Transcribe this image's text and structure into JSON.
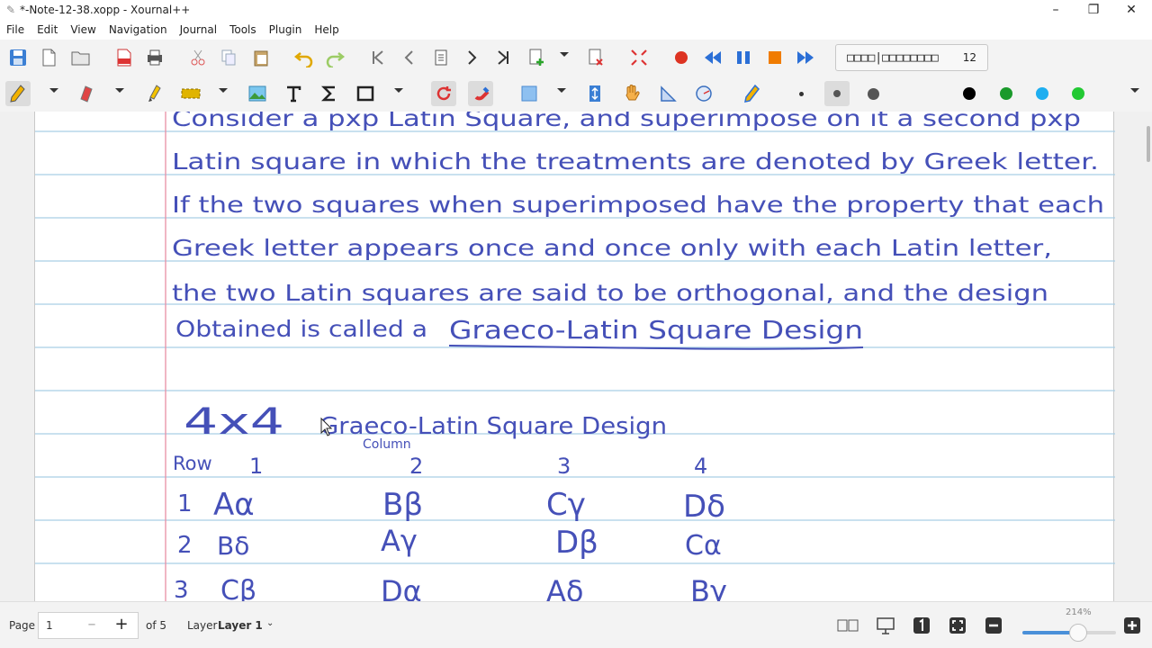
{
  "window": {
    "title": "*-Note-12-38.xopp - Xournal++",
    "minimize": "–",
    "maximize": "❐",
    "close": "✕"
  },
  "menu": [
    "File",
    "Edit",
    "View",
    "Navigation",
    "Journal",
    "Tools",
    "Plugin",
    "Help"
  ],
  "toolbar": {
    "page_selector_name": "□□□□|□□□□□□□□",
    "page_selector_count": "12",
    "colors": {
      "accent_red": "#d33",
      "accent_blue": "#2b6fd6",
      "swatch_black": "#000000",
      "swatch_green": "#1a9a2b",
      "swatch_cyan": "#1eaef0",
      "swatch_lime": "#22c933"
    }
  },
  "note": {
    "ink_color": "#4550b8",
    "rule_color": "#a9cfe5",
    "margin_color": "#e88fa3",
    "lines": [
      "Consider a pxp Latin Square, and superimpose on it a second pxp",
      "Latin square in which the treatments are denoted by Greek letter.",
      "If the two squares when superimposed have the property that each",
      "Greek letter appears once and once only with each Latin letter,",
      "the two Latin squares are said to be orthogonal, and the design",
      "Obtained is called a"
    ],
    "emphasis": "Graeco-Latin Square Design",
    "heading_size": "4x4",
    "heading_title": "Graeco-Latin Square Design",
    "column_label": "Column",
    "row_label": "Row",
    "col_numbers": [
      "1",
      "2",
      "3",
      "4"
    ],
    "rows": [
      {
        "num": "1",
        "cells": [
          "Aα",
          "Bβ",
          "Cγ",
          "Dδ"
        ]
      },
      {
        "num": "2",
        "cells": [
          "Bδ",
          "Aγ",
          "Dβ",
          "Cα"
        ]
      },
      {
        "num": "3",
        "cells": [
          "Cβ",
          "Dα",
          "Aδ",
          "Bγ"
        ]
      }
    ]
  },
  "status": {
    "page_label": "Page",
    "page_value": "1",
    "minus": "–",
    "plus": "+",
    "of_pages": "of 5",
    "layer_label": "Layer",
    "layer_value": "Layer 1",
    "zoom": "214%",
    "zoom_fraction": 0.6
  }
}
